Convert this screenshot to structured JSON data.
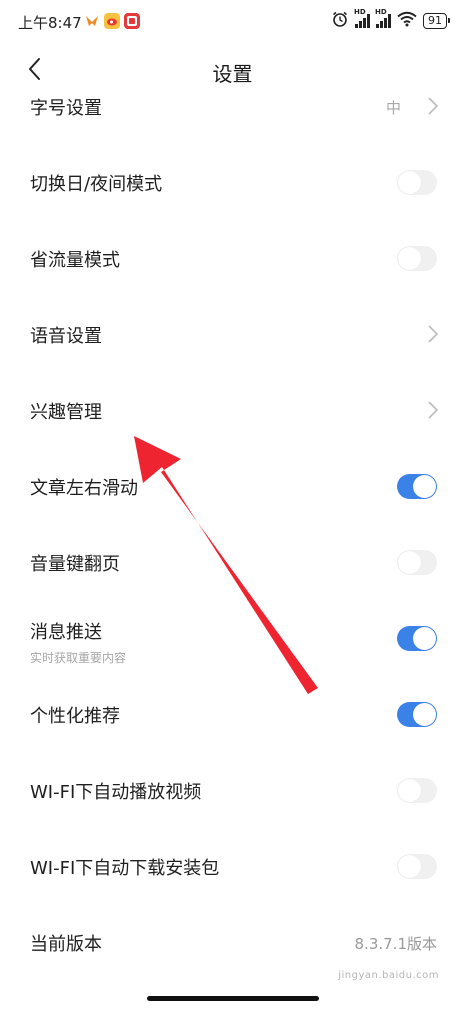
{
  "status_bar": {
    "time": "上午8:47",
    "signal_label_1": "HD",
    "signal_label_2": "HD",
    "battery": "91"
  },
  "header": {
    "title": "设置"
  },
  "settings": [
    {
      "label": "字号设置",
      "kind": "chevron",
      "value": "中"
    },
    {
      "label": "切换日/夜间模式",
      "kind": "toggle",
      "on": false
    },
    {
      "label": "省流量模式",
      "kind": "toggle",
      "on": false
    },
    {
      "label": "语音设置",
      "kind": "chevron"
    },
    {
      "label": "兴趣管理",
      "kind": "chevron"
    },
    {
      "label": "文章左右滑动",
      "kind": "toggle",
      "on": true
    },
    {
      "label": "音量键翻页",
      "kind": "toggle",
      "on": false
    },
    {
      "label": "消息推送",
      "kind": "toggle",
      "on": true,
      "sub": "实时获取重要内容"
    },
    {
      "label": "个性化推荐",
      "kind": "toggle",
      "on": true
    },
    {
      "label": "WI-FI下自动播放视频",
      "kind": "toggle",
      "on": false
    },
    {
      "label": "WI-FI下自动下载安装包",
      "kind": "toggle",
      "on": false
    },
    {
      "label": "当前版本",
      "kind": "version",
      "value": "8.3.7.1版本"
    }
  ],
  "watermark": "jingyan.baidu.com",
  "colors": {
    "toggle_on": "#3b82e8",
    "toggle_off": "#f0f0f0",
    "annotation_arrow": "#ee2430"
  },
  "icons": {
    "back": "chevron-left-icon",
    "chevron": "chevron-right-icon",
    "alarm": "alarm-icon",
    "wifi": "wifi-icon"
  }
}
